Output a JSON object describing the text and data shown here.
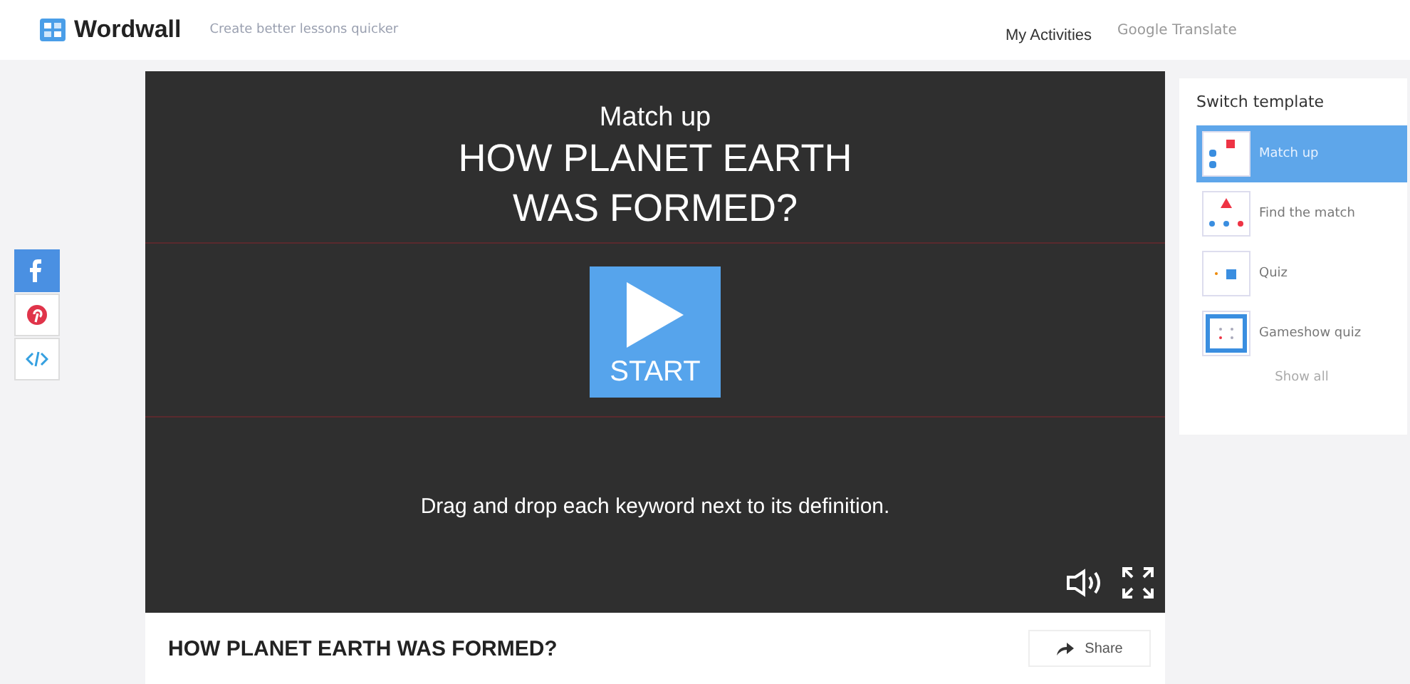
{
  "header": {
    "logo": "Wordwall",
    "tagline": "Create better lessons quicker",
    "nav": [
      "My Activities",
      "Google Translate"
    ]
  },
  "share_buttons": [
    {
      "kind": "facebook"
    },
    {
      "kind": "pinterest"
    },
    {
      "kind": "embed"
    }
  ],
  "game": {
    "type": "Match up",
    "title": "HOW PLANET EARTH WAS FORMED?",
    "start": "START",
    "instructions": "Drag and drop each keyword next to its definition."
  },
  "activity_title": "HOW PLANET EARTH WAS FORMED?",
  "share": "Share",
  "templates": {
    "heading": "Switch template",
    "items": [
      {
        "label": "Match up",
        "selected": true
      },
      {
        "label": "Find the match",
        "selected": false
      },
      {
        "label": "Quiz",
        "selected": false
      },
      {
        "label": "Gameshow quiz",
        "selected": false
      }
    ],
    "show_all": "Show all"
  }
}
